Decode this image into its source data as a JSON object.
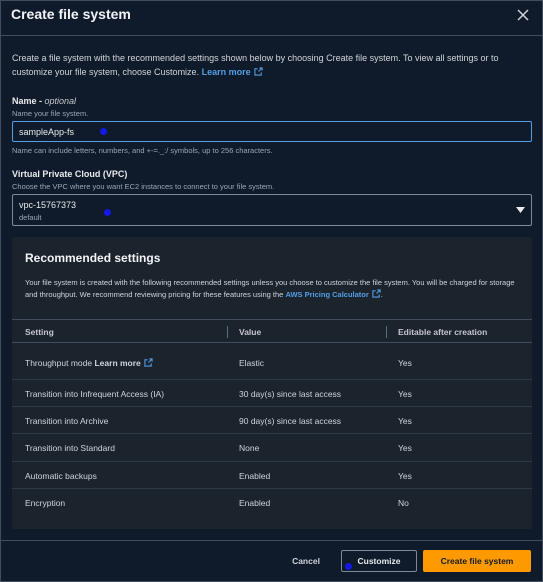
{
  "modal": {
    "title": "Create file system",
    "intro": "Create a file system with the recommended settings shown below by choosing Create file system. To view all settings or to customize your file system, choose Customize.",
    "learn_more": "Learn more"
  },
  "name_field": {
    "label": "Name",
    "optional": "optional",
    "description": "Name your file system.",
    "value": "sampleApp-fs",
    "constraint": "Name can include letters, numbers, and +-=._:/ symbols, up to 256 characters."
  },
  "vpc_field": {
    "label": "Virtual Private Cloud (VPC)",
    "description": "Choose the VPC where you want EC2 instances to connect to your file system.",
    "selected": "vpc-15767373",
    "selected_sub": "default"
  },
  "recommended": {
    "title": "Recommended settings",
    "description_part1": "Your file system is created with the following recommended settings unless you choose to customize the file system. You will be charged for storage and throughput. We recommend reviewing pricing for these features using the",
    "pricing_link": "AWS Pricing Calculator",
    "description_end": ".",
    "columns": [
      "Setting",
      "Value",
      "Editable after creation"
    ],
    "rows": [
      {
        "setting": "Throughput mode",
        "link": "Learn more",
        "value": "Elastic",
        "editable": "Yes"
      },
      {
        "setting": "Transition into Infrequent Access (IA)",
        "value": "30 day(s) since last access",
        "editable": "Yes"
      },
      {
        "setting": "Transition into Archive",
        "value": "90 day(s) since last access",
        "editable": "Yes"
      },
      {
        "setting": "Transition into Standard",
        "value": "None",
        "editable": "Yes"
      },
      {
        "setting": "Automatic backups",
        "value": "Enabled",
        "editable": "Yes"
      },
      {
        "setting": "Encryption",
        "value": "Enabled",
        "editable": "No"
      }
    ]
  },
  "footer": {
    "cancel": "Cancel",
    "customize": "Customize",
    "create": "Create file system"
  },
  "colors": {
    "background": "#0f1b2a",
    "panel": "#1b232d",
    "link": "#539fe5",
    "primary_button": "#ff9900",
    "cursor_marker": "#1418e6"
  },
  "icons": [
    "close-icon",
    "external-link-icon",
    "caret-down-icon"
  ]
}
